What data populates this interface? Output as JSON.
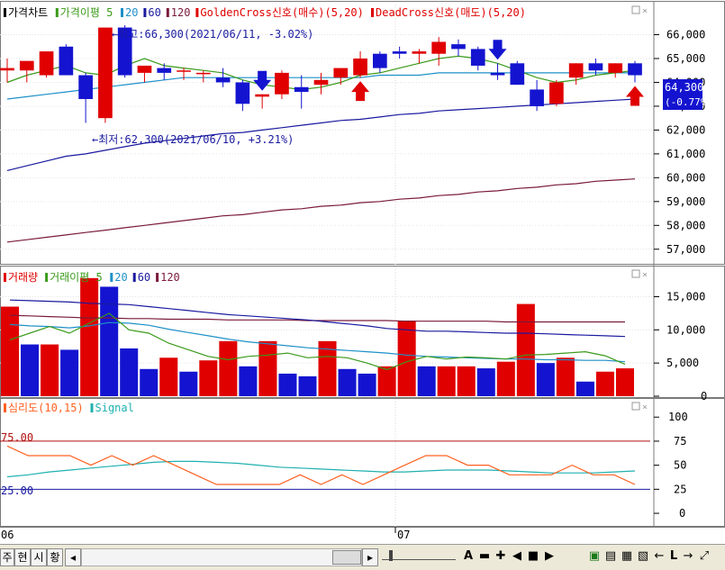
{
  "price_panel": {
    "legend": [
      {
        "label": "가격차트",
        "color": "#000000"
      },
      {
        "label": "가격이평 5",
        "color": "#3a9a1a"
      },
      {
        "label": "20",
        "color": "#1e90c8"
      },
      {
        "label": "60",
        "color": "#1a1aa0"
      },
      {
        "label": "120",
        "color": "#7a1a3a"
      },
      {
        "label": "GoldenCross신호(매수)(5,20)",
        "color": "#e00000"
      },
      {
        "label": "DeadCross신호(매도)(5,20)",
        "color": "#e00000"
      }
    ],
    "high_annotation": "←최고:66,300(2021/06/11, -3.02%)",
    "low_annotation": "←최저:62,300(2021/06/10, +3.21%)",
    "current_price_label": "64,300",
    "current_change_label": "(-0.77%)"
  },
  "volume_panel": {
    "legend": [
      {
        "label": "거래량",
        "color": "#e00000"
      },
      {
        "label": "거래이평 5",
        "color": "#3a9a1a"
      },
      {
        "label": "20",
        "color": "#1e90c8"
      },
      {
        "label": "60",
        "color": "#1a1aa0"
      },
      {
        "label": "120",
        "color": "#7a1a3a"
      }
    ]
  },
  "psych_panel": {
    "legend": [
      {
        "label": "심리도(10,15)",
        "color": "#ff6020"
      },
      {
        "label": "Signal",
        "color": "#20b0b0"
      }
    ],
    "level_high_label": "75.00",
    "level_low_label": "25.00"
  },
  "x_axis": {
    "labels": [
      "06",
      "07"
    ]
  },
  "toolbar": {
    "tabs": [
      "주",
      "현",
      "시",
      "황"
    ],
    "scroll_left_icon": "◂",
    "scroll_right_icon": "▸",
    "letter_a": "A",
    "letter_l": "L"
  },
  "chart_data": [
    {
      "type": "candlestick",
      "title": "가격차트",
      "ylim": [
        56500,
        66700
      ],
      "y_ticks": [
        "66,000",
        "65,000",
        "64,000",
        "63,000",
        "62,000",
        "61,000",
        "60,000",
        "59,000",
        "58,000",
        "57,000"
      ],
      "candles": [
        {
          "o": 64500,
          "h": 65000,
          "l": 64000,
          "c": 64600
        },
        {
          "o": 64500,
          "h": 64600,
          "l": 64000,
          "c": 64900
        },
        {
          "o": 64300,
          "h": 65200,
          "l": 64200,
          "c": 65300
        },
        {
          "o": 65500,
          "h": 65600,
          "l": 64300,
          "c": 64300
        },
        {
          "o": 64300,
          "h": 64400,
          "l": 62300,
          "c": 63300
        },
        {
          "o": 62500,
          "h": 66300,
          "l": 62300,
          "c": 66300
        },
        {
          "o": 66300,
          "h": 66400,
          "l": 64200,
          "c": 64300
        },
        {
          "o": 64400,
          "h": 64500,
          "l": 64000,
          "c": 64700
        },
        {
          "o": 64600,
          "h": 64800,
          "l": 64100,
          "c": 64400
        },
        {
          "o": 64500,
          "h": 64600,
          "l": 64100,
          "c": 64500
        },
        {
          "o": 64400,
          "h": 64500,
          "l": 64000,
          "c": 64400
        },
        {
          "o": 64200,
          "h": 64600,
          "l": 63800,
          "c": 64000
        },
        {
          "o": 64000,
          "h": 64100,
          "l": 62800,
          "c": 63100
        },
        {
          "o": 63400,
          "h": 63500,
          "l": 62900,
          "c": 63500
        },
        {
          "o": 63500,
          "h": 64500,
          "l": 63300,
          "c": 64400
        },
        {
          "o": 63800,
          "h": 64300,
          "l": 62900,
          "c": 63600
        },
        {
          "o": 63900,
          "h": 64400,
          "l": 63500,
          "c": 64100
        },
        {
          "o": 64200,
          "h": 64500,
          "l": 63900,
          "c": 64600
        },
        {
          "o": 64300,
          "h": 65300,
          "l": 64200,
          "c": 65000
        },
        {
          "o": 65200,
          "h": 65300,
          "l": 64400,
          "c": 64600
        },
        {
          "o": 65300,
          "h": 65500,
          "l": 65000,
          "c": 65200
        },
        {
          "o": 65200,
          "h": 65400,
          "l": 64800,
          "c": 65300
        },
        {
          "o": 65200,
          "h": 65900,
          "l": 64700,
          "c": 65700
        },
        {
          "o": 65600,
          "h": 65800,
          "l": 65100,
          "c": 65400
        },
        {
          "o": 65400,
          "h": 65500,
          "l": 64500,
          "c": 64700
        },
        {
          "o": 64400,
          "h": 64800,
          "l": 64100,
          "c": 64300
        },
        {
          "o": 64800,
          "h": 64900,
          "l": 63900,
          "c": 63900
        },
        {
          "o": 63700,
          "h": 64100,
          "l": 62800,
          "c": 63000
        },
        {
          "o": 63100,
          "h": 64100,
          "l": 63000,
          "c": 64000
        },
        {
          "o": 64200,
          "h": 64800,
          "l": 63900,
          "c": 64800
        },
        {
          "o": 64800,
          "h": 65000,
          "l": 64300,
          "c": 64500
        },
        {
          "o": 64400,
          "h": 64800,
          "l": 64200,
          "c": 64800
        },
        {
          "o": 64800,
          "h": 64900,
          "l": 64000,
          "c": 64300
        }
      ],
      "ma5": [
        64000,
        64300,
        64500,
        64700,
        64400,
        64300,
        64700,
        65000,
        64700,
        64600,
        64500,
        64400,
        64100,
        63900,
        63800,
        63700,
        63800,
        64000,
        64300,
        64400,
        64600,
        64800,
        65000,
        65100,
        65000,
        64800,
        64500,
        64200,
        64000,
        64100,
        64300,
        64400,
        64500
      ],
      "ma20": [
        63300,
        63400,
        63500,
        63600,
        63700,
        63800,
        63900,
        64000,
        64100,
        64200,
        64200,
        64200,
        64200,
        64200,
        64200,
        64200,
        64200,
        64200,
        64200,
        64300,
        64300,
        64300,
        64400,
        64400,
        64400,
        64400,
        64400,
        64400,
        64400,
        64400,
        64400,
        64400,
        64400
      ],
      "ma60": [
        60300,
        60500,
        60700,
        60900,
        61000,
        61150,
        61300,
        61450,
        61550,
        61650,
        61750,
        61850,
        61900,
        62000,
        62100,
        62200,
        62300,
        62400,
        62450,
        62550,
        62650,
        62700,
        62800,
        62850,
        62900,
        62950,
        63000,
        63050,
        63100,
        63150,
        63200,
        63250,
        63300
      ],
      "ma120": [
        57300,
        57400,
        57500,
        57600,
        57700,
        57800,
        57900,
        58000,
        58100,
        58200,
        58300,
        58400,
        58450,
        58550,
        58650,
        58700,
        58800,
        58850,
        58950,
        59000,
        59100,
        59150,
        59250,
        59300,
        59400,
        59450,
        59550,
        59600,
        59700,
        59750,
        59850,
        59900,
        59950
      ],
      "golden_cross_idx": [
        18,
        32
      ],
      "dead_cross_idx": [
        13,
        25
      ],
      "current_price": 64300,
      "high": {
        "value": 66300,
        "date": "2021/06/11",
        "change": "-3.02%"
      },
      "low": {
        "value": 62300,
        "date": "2021/06/10",
        "change": "+3.21%"
      }
    },
    {
      "type": "bar",
      "title": "거래량",
      "ylim": [
        0,
        19000
      ],
      "y_ticks": [
        "15,000",
        "10,000",
        "5,000",
        "0"
      ],
      "tick_values": [
        15000,
        10000,
        5000,
        0
      ],
      "values": [
        13500,
        7800,
        7800,
        7000,
        17800,
        16500,
        7200,
        4100,
        5800,
        3700,
        5400,
        8300,
        4500,
        8300,
        3400,
        3000,
        8300,
        4100,
        3400,
        4500,
        11400,
        4500,
        4500,
        4500,
        4200,
        5200,
        13900,
        5000,
        5800,
        2200,
        3700,
        4200
      ],
      "up": [
        true,
        false,
        true,
        false,
        true,
        false,
        false,
        false,
        true,
        false,
        true,
        true,
        false,
        true,
        false,
        false,
        true,
        false,
        false,
        true,
        true,
        false,
        true,
        true,
        false,
        true,
        true,
        false,
        true,
        false,
        true,
        true
      ],
      "ma5": [
        8500,
        9500,
        10500,
        9500,
        11000,
        12500,
        10000,
        9500,
        8000,
        7000,
        6000,
        5500,
        6000,
        6200,
        6500,
        5800,
        6000,
        5800,
        5000,
        4000,
        5200,
        6000,
        5600,
        5900,
        5800,
        5600,
        6200,
        6300,
        6500,
        6700,
        6100,
        4800
      ],
      "ma20": [
        10800,
        10600,
        10500,
        10300,
        10600,
        11100,
        11000,
        10700,
        10100,
        9600,
        9100,
        8600,
        8200,
        7900,
        7600,
        7300,
        7100,
        6900,
        6700,
        6500,
        6200,
        6000,
        5900,
        5800,
        5700,
        5600,
        5600,
        5500,
        5500,
        5400,
        5400,
        5200
      ],
      "ma60": [
        14500,
        14400,
        14300,
        14200,
        14000,
        13900,
        13800,
        13500,
        13200,
        12900,
        12600,
        12300,
        12100,
        11900,
        11700,
        11500,
        11200,
        10900,
        10600,
        10200,
        10000,
        9800,
        9800,
        9700,
        9600,
        9500,
        9500,
        9400,
        9300,
        9200,
        9100,
        9000
      ],
      "ma120": [
        12200,
        12100,
        12000,
        11900,
        11800,
        11800,
        11700,
        11700,
        11600,
        11600,
        11600,
        11500,
        11500,
        11500,
        11500,
        11400,
        11400,
        11400,
        11400,
        11400,
        11300,
        11300,
        11300,
        11300,
        11300,
        11200,
        11200,
        11200,
        11200,
        11200,
        11200,
        11200
      ]
    },
    {
      "type": "line",
      "title": "심리도(10,15)",
      "ylim": [
        -14,
        118
      ],
      "y_ticks": [
        "100",
        "75",
        "50",
        "25",
        "0"
      ],
      "tick_values": [
        100,
        75,
        50,
        25,
        0
      ],
      "levels": [
        75,
        25
      ],
      "series": [
        {
          "name": "심리도(10,15)",
          "color": "#ff6020",
          "values": [
            70,
            60,
            60,
            60,
            50,
            60,
            50,
            60,
            50,
            40,
            30,
            30,
            30,
            30,
            40,
            30,
            40,
            30,
            40,
            50,
            60,
            60,
            50,
            50,
            40,
            40,
            40,
            50,
            40,
            40,
            30
          ]
        },
        {
          "name": "Signal",
          "color": "#20b0b0",
          "values": [
            38,
            40,
            43,
            45,
            47,
            49,
            51,
            53,
            54,
            54,
            53,
            52,
            50,
            48,
            47,
            46,
            45,
            44,
            43,
            43,
            44,
            45,
            45,
            45,
            44,
            43,
            42,
            42,
            42,
            43,
            44
          ]
        }
      ]
    }
  ]
}
